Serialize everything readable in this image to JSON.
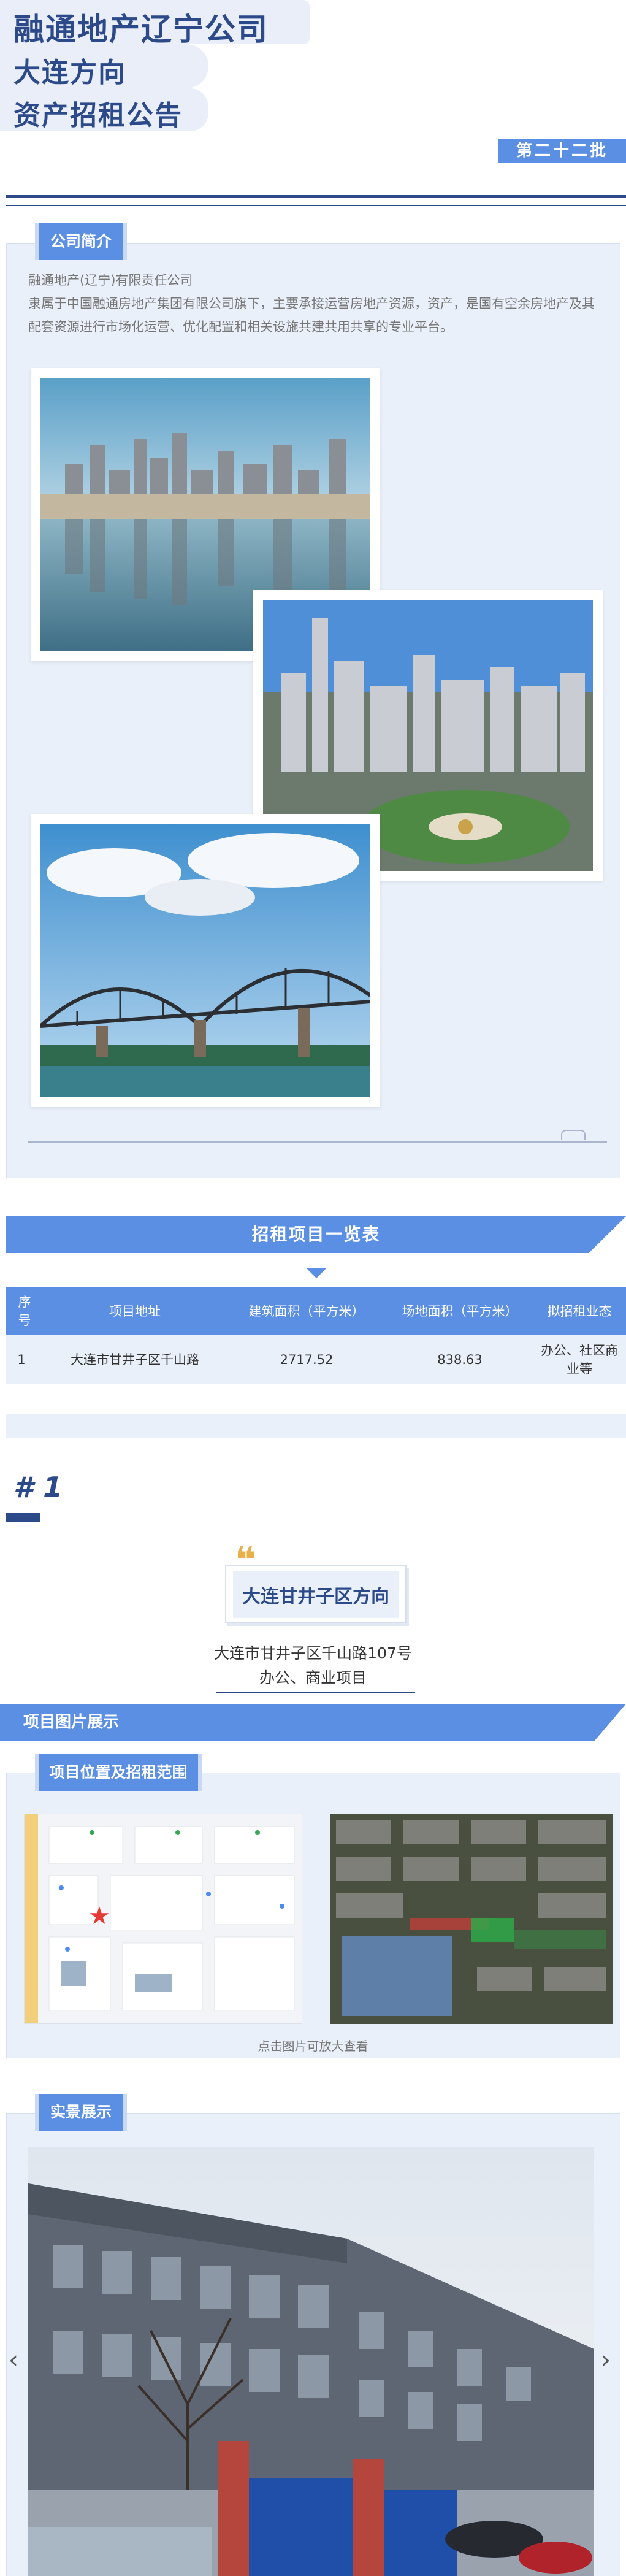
{
  "header": {
    "line1": "融通地产辽宁公司",
    "line2": "大连方向",
    "line3": "资产招租公告",
    "batch": "第二十二批"
  },
  "intro": {
    "tab": "公司简介",
    "company": "融通地产(辽宁)有限责任公司",
    "description": "隶属于中国融通房地产集团有限公司旗下，主要承接运营房地产资源，资产，是国有空余房地产及其配套资源进行市场化运营、优化配置和相关设施共建共用共享的专业平台。"
  },
  "rental_list": {
    "title": "招租项目一览表",
    "headers": [
      "序号",
      "项目地址",
      "建筑面积（平方米）",
      "场地面积（平方米）",
      "拟招租业态"
    ],
    "rows": [
      [
        "1",
        "大连市甘井子区千山路",
        "2717.52",
        "838.63",
        "办公、社区商业等"
      ]
    ]
  },
  "project": {
    "number": "# 1",
    "name": "大连甘井子区方向",
    "address": "大连市甘井子区千山路107号",
    "type": "办公、商业项目",
    "images_banner": "项目图片展示",
    "location_tab": "位置及招租范围",
    "location_tab_prefix": "项目",
    "click_hint": "点击图片可放大查看",
    "real_tab": "实景展示"
  },
  "colors": {
    "primary_dark": "#2c4a8a",
    "accent_blue": "#5b8fe3",
    "panel_bg": "#eaf0fa",
    "quote_gold": "#e8b04b",
    "marker_red": "#e53935"
  },
  "icons": {
    "quote": "quote-icon",
    "prev": "chevron-left-icon",
    "next": "chevron-right-icon",
    "marker": "star-marker-icon"
  }
}
